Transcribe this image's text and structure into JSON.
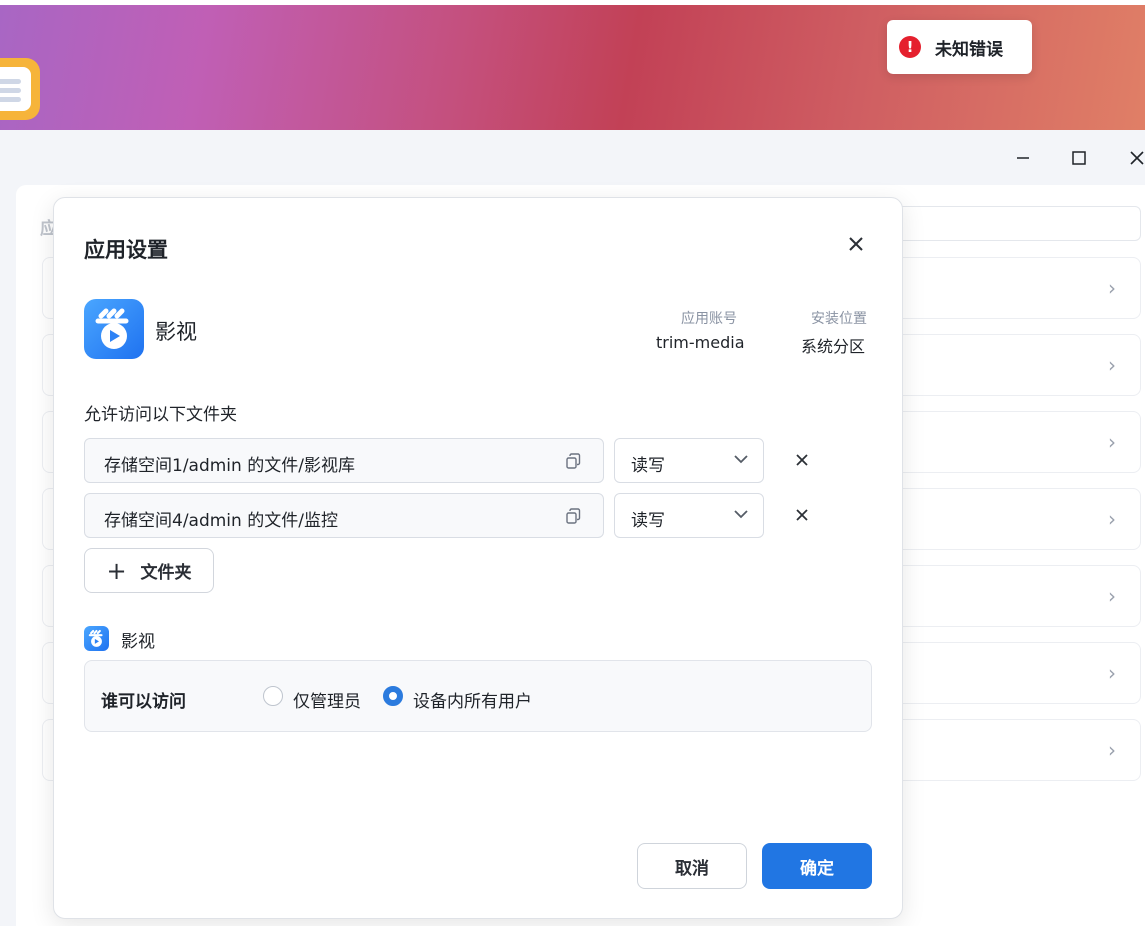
{
  "toast": {
    "text": "未知错误",
    "icon": "error-circle-icon",
    "icon_glyph": "!"
  },
  "window": {
    "minimize": "—",
    "maximize": "☐",
    "close": "✕"
  },
  "background": {
    "label": "应",
    "chevron": "›"
  },
  "dialog": {
    "title": "应用设置",
    "close": "✕",
    "app": {
      "name": "影视",
      "account_label": "应用账号",
      "account_value": "trim-media",
      "location_label": "安装位置",
      "location_value": "系统分区"
    },
    "folders_label": "允许访问以下文件夹",
    "folders": [
      {
        "path": "存储空间1/admin 的文件/影视库",
        "permission": "读写"
      },
      {
        "path": "存储空间4/admin 的文件/监控",
        "permission": "读写"
      }
    ],
    "add_folder": {
      "plus": "+",
      "label": "文件夹"
    },
    "access": {
      "app_name": "影视",
      "label": "谁可以访问",
      "options": [
        {
          "label": "仅管理员",
          "checked": false
        },
        {
          "label": "设备内所有用户",
          "checked": true
        }
      ]
    },
    "cancel": "取消",
    "confirm": "确定"
  },
  "colors": {
    "accent": "#2176e3",
    "error": "#e5202e",
    "app_icon": "#1f72f0"
  }
}
